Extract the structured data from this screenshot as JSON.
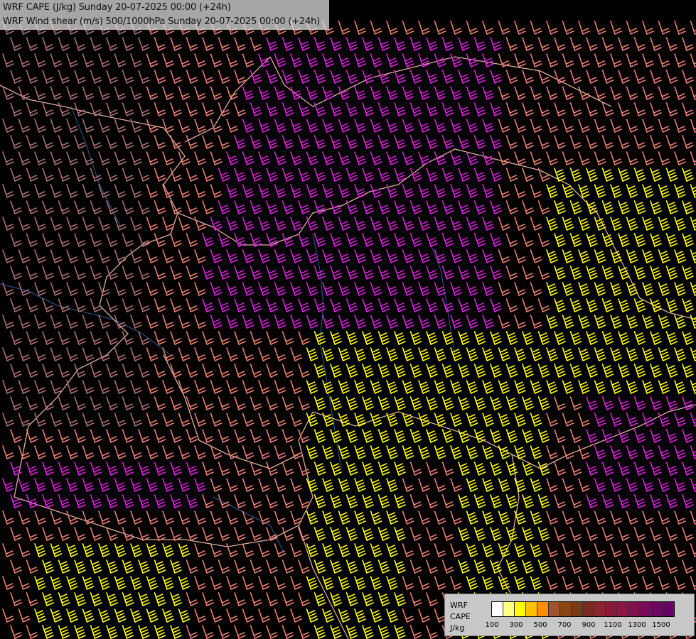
{
  "title": {
    "line1": "WRF CAPE (J/kg) Sunday 20-07-2025 00:00 (+24h)",
    "line2": "WRF Wind shear (m/s) 500/1000hPa Sunday 20-07-2025 00:00 (+24h)"
  },
  "legend": {
    "label_model": "WRF",
    "label_field": "CAPE",
    "label_unit": "J/kg",
    "tick_labels": [
      "100",
      "300",
      "500",
      "700",
      "900",
      "1100",
      "1300",
      "1500"
    ],
    "colors": [
      "#ffffff",
      "#ffff80",
      "#ffff00",
      "#ffc000",
      "#ff8c00",
      "#a0522d",
      "#8b4513",
      "#7a3a1a",
      "#7a2a20",
      "#8b2331",
      "#8b1a3a",
      "#8b1545",
      "#80104f",
      "#7a0a58",
      "#700560",
      "#690066"
    ]
  },
  "colors": {
    "background": "#000000",
    "barb_yellow": "#ffff00",
    "barb_salmon": "#f08070",
    "barb_magenta": "#e020e0",
    "barb_brown": "#b07070",
    "border": "#e0b0a0",
    "river": "#3060a0"
  }
}
